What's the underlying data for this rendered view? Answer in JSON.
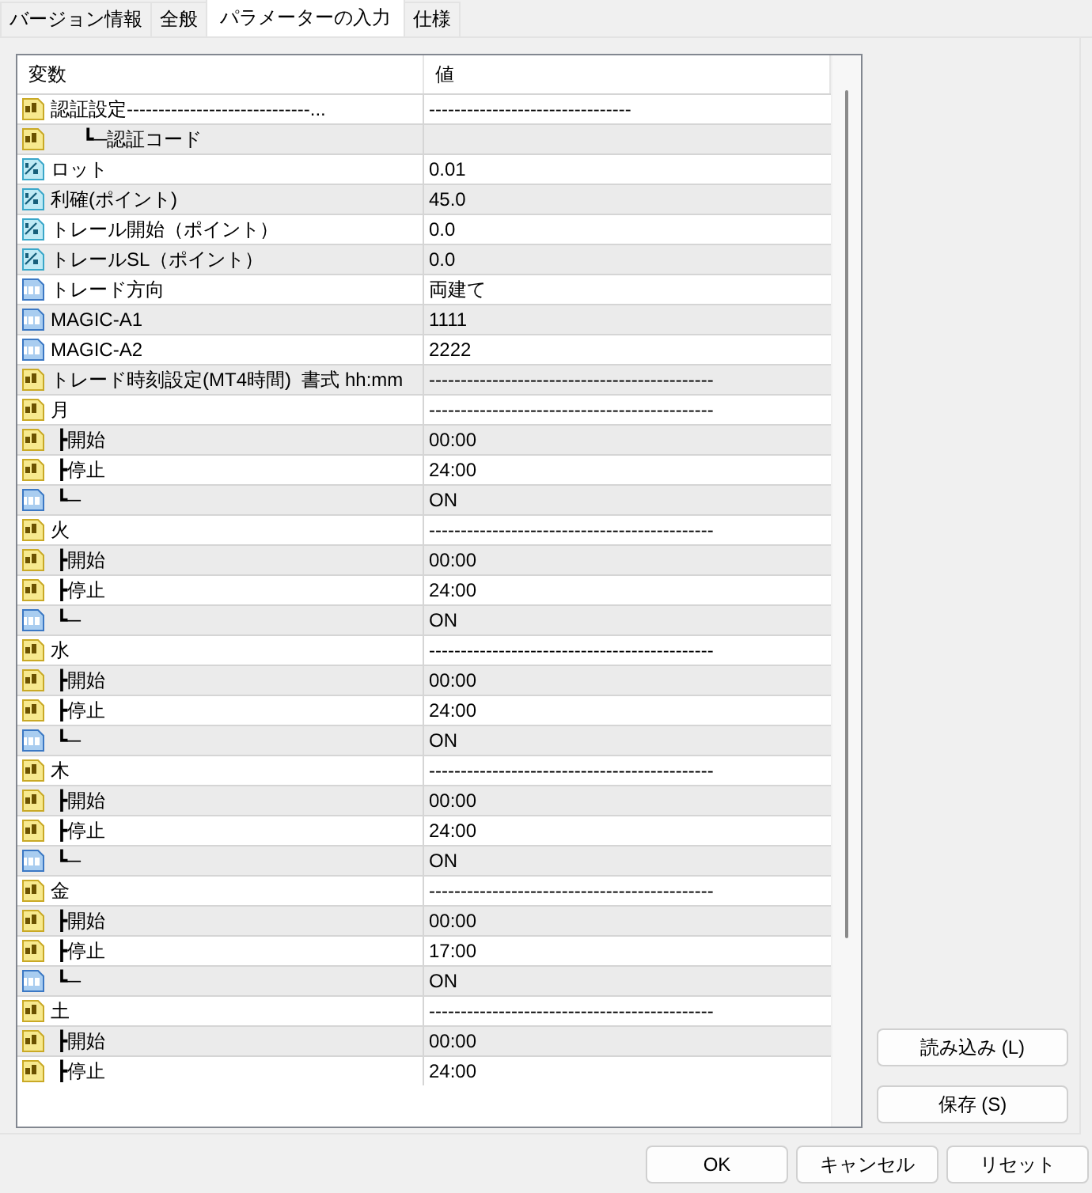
{
  "tabs": [
    {
      "label": "バージョン情報",
      "selected": false
    },
    {
      "label": "全般",
      "selected": false
    },
    {
      "label": "パラメーターの入力",
      "selected": true
    },
    {
      "label": "仕様",
      "selected": false
    }
  ],
  "table": {
    "columns": [
      "変数",
      "値"
    ],
    "rows": [
      {
        "kind": "string",
        "name": "認証設定-----------------------------...",
        "value": "--------------------------------"
      },
      {
        "kind": "string",
        "name": "      ┗─認証コード"
      },
      {
        "kind": "double",
        "name": "ロット",
        "value": "0.01"
      },
      {
        "kind": "double",
        "name": "利確(ポイント)",
        "value": "45.0"
      },
      {
        "kind": "double",
        "name": "トレール開始（ポイント）",
        "value": "0.0"
      },
      {
        "kind": "double",
        "name": "トレールSL（ポイント）",
        "value": "0.0"
      },
      {
        "kind": "int",
        "name": "トレード方向",
        "value": "両建て"
      },
      {
        "kind": "int",
        "name": "MAGIC-A1",
        "value": "1111"
      },
      {
        "kind": "int",
        "name": "MAGIC-A2",
        "value": "2222"
      },
      {
        "kind": "string",
        "name": "トレード時刻設定(MT4時間)  書式 hh:mm",
        "value": "---------------------------------------------"
      },
      {
        "kind": "string",
        "name": "月",
        "value": "---------------------------------------------"
      },
      {
        "kind": "string",
        "name": " ┣開始",
        "value": "00:00"
      },
      {
        "kind": "string",
        "name": " ┣停止",
        "value": "24:00"
      },
      {
        "kind": "int",
        "name": " ┗─",
        "value": "ON"
      },
      {
        "kind": "string",
        "name": "火",
        "value": "---------------------------------------------"
      },
      {
        "kind": "string",
        "name": " ┣開始",
        "value": "00:00"
      },
      {
        "kind": "string",
        "name": " ┣停止",
        "value": "24:00"
      },
      {
        "kind": "int",
        "name": " ┗─",
        "value": "ON"
      },
      {
        "kind": "string",
        "name": "水",
        "value": "---------------------------------------------"
      },
      {
        "kind": "string",
        "name": " ┣開始",
        "value": "00:00"
      },
      {
        "kind": "string",
        "name": " ┣停止",
        "value": "24:00"
      },
      {
        "kind": "int",
        "name": " ┗─",
        "value": "ON"
      },
      {
        "kind": "string",
        "name": "木",
        "value": "---------------------------------------------"
      },
      {
        "kind": "string",
        "name": " ┣開始",
        "value": "00:00"
      },
      {
        "kind": "string",
        "name": " ┣停止",
        "value": "24:00"
      },
      {
        "kind": "int",
        "name": " ┗─",
        "value": "ON"
      },
      {
        "kind": "string",
        "name": "金",
        "value": "---------------------------------------------"
      },
      {
        "kind": "string",
        "name": " ┣開始",
        "value": "00:00"
      },
      {
        "kind": "string",
        "name": " ┣停止",
        "value": "17:00"
      },
      {
        "kind": "int",
        "name": " ┗─",
        "value": "ON"
      },
      {
        "kind": "string",
        "name": "土",
        "value": "---------------------------------------------"
      },
      {
        "kind": "string",
        "name": " ┣開始",
        "value": "00:00"
      },
      {
        "kind": "string",
        "name": " ┣停止",
        "value": "24:00"
      }
    ]
  },
  "side_buttons": [
    "読み込み (L)",
    "保存 (S)"
  ],
  "buttons": [
    "OK",
    "キャンセル",
    "リセット"
  ]
}
